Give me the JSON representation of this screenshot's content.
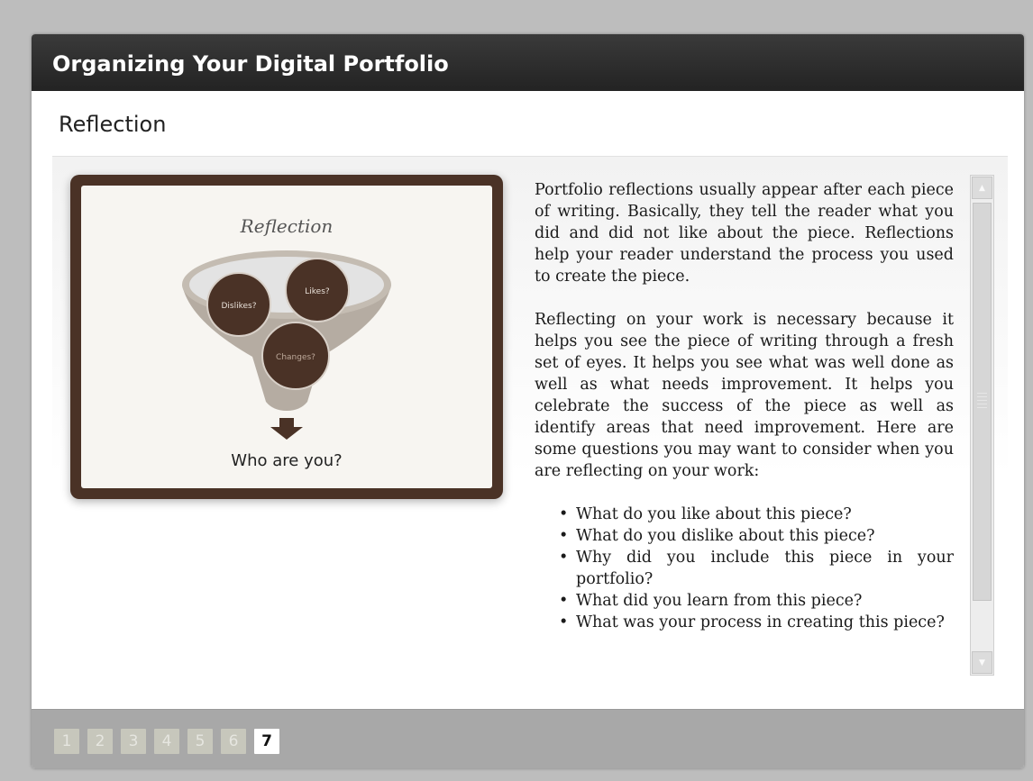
{
  "window": {
    "title": "Organizing Your Digital Portfolio"
  },
  "page": {
    "heading": "Reflection"
  },
  "slide": {
    "title": "Reflection",
    "circles": [
      "Dislikes?",
      "Likes?",
      "Changes?"
    ],
    "caption": "Who are you?",
    "colors": {
      "frame": "#4a3226",
      "circle": "#4a3226",
      "funnel": "#b5aca2"
    }
  },
  "text": {
    "paragraphs": [
      "Portfolio reflections usually appear after each piece of writing. Basically, they tell the reader what you did and did not like about the piece. Reflections help your reader understand the process you used to create the piece.",
      "Reflecting on your work is necessary because it helps you see the piece of writing through a fresh set of eyes. It helps you see what was well done as well as what needs improvement. It helps you celebrate the success of the piece as well as identify areas that need improvement. Here are some questions you may want to consider when you are reflecting on your work:"
    ],
    "questions": [
      "What do you like about this piece?",
      "What do you dislike about this piece?",
      " Why did you include this piece in your portfolio?",
      "What did you learn from this piece?",
      " What was your process in creating this piece?"
    ]
  },
  "scrollbar": {
    "up_icon": "triangle-up",
    "down_icon": "triangle-down"
  },
  "pager": {
    "pages": [
      "1",
      "2",
      "3",
      "4",
      "5",
      "6",
      "7"
    ],
    "current": "7"
  }
}
